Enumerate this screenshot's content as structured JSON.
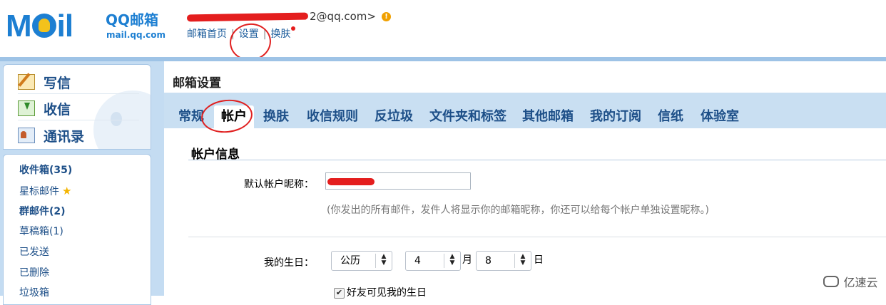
{
  "header": {
    "logo_text": "Mail",
    "logo_qq": "QQ邮箱",
    "logo_url": "mail.qq.com",
    "user_email_suffix": "2@qq.com>",
    "links": [
      {
        "label": "邮箱首页"
      },
      {
        "label": "设置"
      },
      {
        "label": "换肤"
      }
    ],
    "sep": "|"
  },
  "sidebar": {
    "actions": [
      {
        "label": "写信",
        "icon": "pencil-write-icon"
      },
      {
        "label": "收信",
        "icon": "inbox-download-icon"
      },
      {
        "label": "通讯录",
        "icon": "address-book-icon"
      }
    ],
    "folders": [
      {
        "label": "收件箱(35)",
        "bold": true
      },
      {
        "label": "星标邮件",
        "bold": false,
        "star": "★"
      },
      {
        "label": "群邮件(2)",
        "bold": true
      },
      {
        "label": "草稿箱(1)",
        "bold": false
      },
      {
        "label": "已发送",
        "bold": false
      },
      {
        "label": "已删除",
        "bold": false
      },
      {
        "label": "垃圾箱",
        "bold": false
      }
    ]
  },
  "main": {
    "title": "邮箱设置",
    "tabs": [
      {
        "label": "常规"
      },
      {
        "label": "帐户",
        "active": true
      },
      {
        "label": "换肤"
      },
      {
        "label": "收信规则"
      },
      {
        "label": "反垃圾"
      },
      {
        "label": "文件夹和标签"
      },
      {
        "label": "其他邮箱"
      },
      {
        "label": "我的订阅"
      },
      {
        "label": "信纸"
      },
      {
        "label": "体验室"
      }
    ]
  },
  "account": {
    "section_title": "帐户信息",
    "nickname_label": "默认帐户昵称：",
    "nickname_hint": "(你发出的所有邮件，发件人将显示你的邮箱昵称，你还可以给每个帐户单独设置昵称。)",
    "birthday_label": "我的生日：",
    "calendar_value": "公历",
    "month_value": "4",
    "month_unit": "月",
    "day_value": "8",
    "day_unit": "日",
    "friends_visible_label": "好友可见我的生日",
    "friends_visible_mark": "✔"
  },
  "watermark": {
    "text": "亿速云"
  },
  "colors": {
    "brand_blue": "#1d7fd2",
    "link_blue": "#1d4f88",
    "annotation_red": "#e02020"
  }
}
